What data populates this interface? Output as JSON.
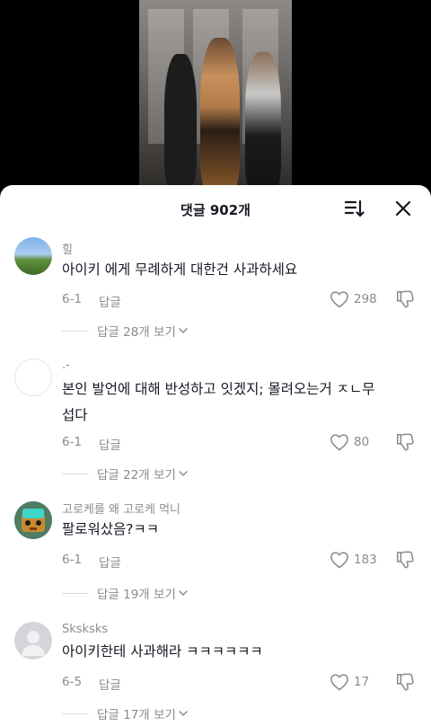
{
  "sheet": {
    "title": "댓글 902개"
  },
  "comments": [
    {
      "username": "힐",
      "text_lines": [
        "아이키 에게 무례하게 대한건 사과하세요"
      ],
      "date": "6-1",
      "reply_label": "답글",
      "likes": "298",
      "view_replies": "답글 28개 보기"
    },
    {
      "username": ".-",
      "text_lines": [
        "본인 발언에 대해 반성하고 잇겠지; 몰려오는거 ㅈㄴ무",
        "섭다"
      ],
      "date": "6-1",
      "reply_label": "답글",
      "likes": "80",
      "view_replies": "답글 22개 보기"
    },
    {
      "username": "고로케를 왜 고로케 먹니",
      "text_lines": [
        "팔로워샀음?ㅋㅋ"
      ],
      "date": "6-1",
      "reply_label": "답글",
      "likes": "183",
      "view_replies": "답글 19개 보기"
    },
    {
      "username": "Sksksks",
      "text_lines": [
        "아이키한테 사과해라 ㅋㅋㅋㅋㅋㅋ"
      ],
      "date": "6-5",
      "reply_label": "답글",
      "likes": "17",
      "view_replies": "답글 17개 보기"
    }
  ],
  "icons": {
    "sort": "sort-icon",
    "close": "close-icon",
    "like": "heart-outline-icon",
    "dislike": "thumbs-down-icon",
    "chevron": "chevron-down-icon"
  },
  "colors": {
    "text": "#161823",
    "secondary": "#8a8b91",
    "sheet": "#ffffff"
  }
}
